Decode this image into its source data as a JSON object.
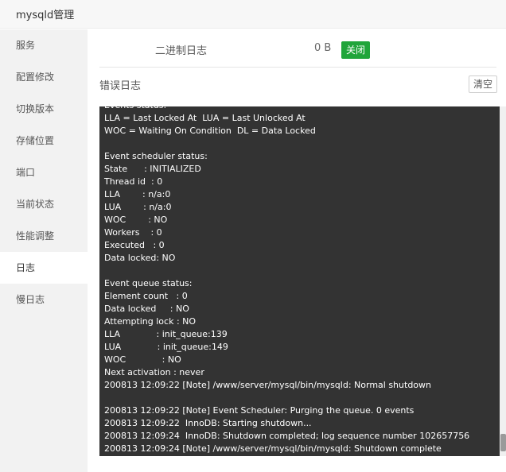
{
  "window": {
    "title": "mysqld管理"
  },
  "sidebar": {
    "items": [
      {
        "label": "服务"
      },
      {
        "label": "配置修改"
      },
      {
        "label": "切换版本"
      },
      {
        "label": "存储位置"
      },
      {
        "label": "端口"
      },
      {
        "label": "当前状态"
      },
      {
        "label": "性能调整"
      },
      {
        "label": "日志",
        "active": true
      },
      {
        "label": "慢日志"
      }
    ]
  },
  "binlog": {
    "label": "二进制日志",
    "size": "0 B",
    "close_label": "关闭"
  },
  "errlog": {
    "label": "错误日志",
    "clear_label": "清空",
    "lines": [
      "Events status:",
      "LLA = Last Locked At  LUA = Last Unlocked At",
      "WOC = Waiting On Condition  DL = Data Locked",
      "",
      "Event scheduler status:",
      "State      : INITIALIZED",
      "Thread id  : 0",
      "LLA        : n/a:0",
      "LUA        : n/a:0",
      "WOC        : NO",
      "Workers    : 0",
      "Executed   : 0",
      "Data locked: NO",
      "",
      "Event queue status:",
      "Element count   : 0",
      "Data locked     : NO",
      "Attempting lock : NO",
      "LLA             : init_queue:139",
      "LUA             : init_queue:149",
      "WOC             : NO",
      "Next activation : never",
      "200813 12:09:22 [Note] /www/server/mysql/bin/mysqld: Normal shutdown",
      "",
      "200813 12:09:22 [Note] Event Scheduler: Purging the queue. 0 events",
      "200813 12:09:22  InnoDB: Starting shutdown...",
      "200813 12:09:24  InnoDB: Shutdown completed; log sequence number 102657756",
      "200813 12:09:24 [Note] /www/server/mysql/bin/mysqld: Shutdown complete"
    ]
  },
  "colors": {
    "accent": "#20a53a",
    "log_bg": "#333333",
    "sidebar_bg": "#f2f2f2"
  }
}
